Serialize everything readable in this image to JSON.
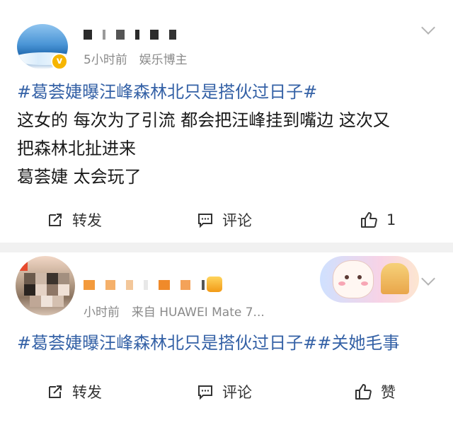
{
  "post1": {
    "username": "L.  J.  ",
    "time": "5小时前",
    "source": "娱乐博主",
    "hashtag": "#葛荟婕曝汪峰森林北只是搭伙过日子#",
    "lines": [
      "这女的  每次为了引流  都会把汪峰挂到嘴边  这次又",
      "把森林北扯进来",
      "葛荟婕  太会玩了"
    ],
    "actions": {
      "repost": "转发",
      "comment": "评论",
      "like_count": "1"
    }
  },
  "post2": {
    "time": "小时前",
    "source": "来自 HUAWEI Mate 7...",
    "hashtag1": "#葛荟婕曝汪峰森林北只是搭伙过日子#",
    "hashtag2": "#关她毛事",
    "actions": {
      "repost": "转发",
      "comment": "评论",
      "like": "赞"
    }
  },
  "colors": {
    "topic": "#3461a6",
    "meta": "#8a8a8a",
    "background": "#f1f1f1"
  }
}
